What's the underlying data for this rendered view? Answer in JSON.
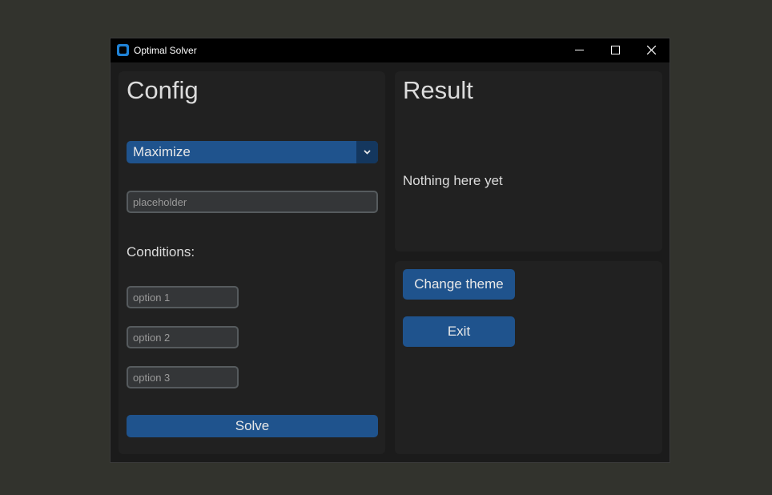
{
  "window": {
    "title": "Optimal Solver",
    "icons": {
      "app": "app-icon",
      "minimize": "minimize-icon",
      "maximize": "maximize-icon",
      "close": "close-icon"
    }
  },
  "config": {
    "heading": "Config",
    "objective": {
      "selected": "Maximize",
      "icon": "chevron-down-icon"
    },
    "main_input": {
      "value": "",
      "placeholder": "placeholder"
    },
    "conditions_label": "Conditions:",
    "options": [
      {
        "value": "",
        "placeholder": "option 1"
      },
      {
        "value": "",
        "placeholder": "option 2"
      },
      {
        "value": "",
        "placeholder": "option 3"
      }
    ],
    "solve_label": "Solve"
  },
  "result": {
    "heading": "Result",
    "text": "Nothing here yet"
  },
  "actions": {
    "change_theme_label": "Change theme",
    "exit_label": "Exit"
  },
  "colors": {
    "accent": "#1f538d",
    "accent_dark": "#14375e",
    "panel": "#212121",
    "window_bg": "#1b1b1b",
    "desktop": "#32332d"
  }
}
